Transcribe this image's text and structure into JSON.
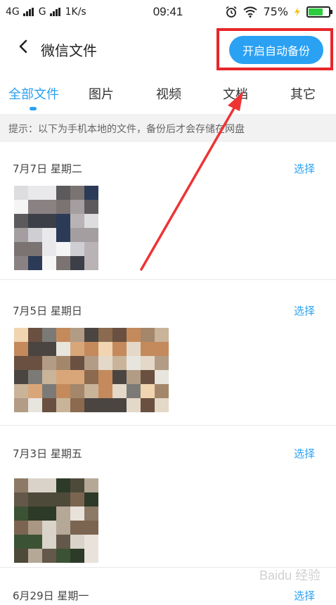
{
  "status_bar": {
    "net1": "4G",
    "net2": "G",
    "speed": "1K/s",
    "time": "09:41",
    "battery_text": "75%",
    "battery_level": 0.75
  },
  "header": {
    "title": "微信文件",
    "backup_button": "开启自动备份"
  },
  "tabs": [
    {
      "label": "全部文件",
      "active": true
    },
    {
      "label": "图片",
      "active": false
    },
    {
      "label": "视频",
      "active": false
    },
    {
      "label": "文档",
      "active": false
    },
    {
      "label": "其它",
      "active": false
    }
  ],
  "tip": "提示：以下为手机本地的文件，备份后才会存储在网盘",
  "groups": [
    {
      "date": "7月7日  星期二",
      "select": "选择"
    },
    {
      "date": "7月5日  星期日",
      "select": "选择"
    },
    {
      "date": "7月3日  星期五",
      "select": "选择"
    },
    {
      "date": "6月29日  星期一",
      "select": "选择"
    }
  ],
  "colors": {
    "accent": "#2aa1f3",
    "highlight_red": "#e8262a"
  },
  "watermark": "Baidu 经验"
}
